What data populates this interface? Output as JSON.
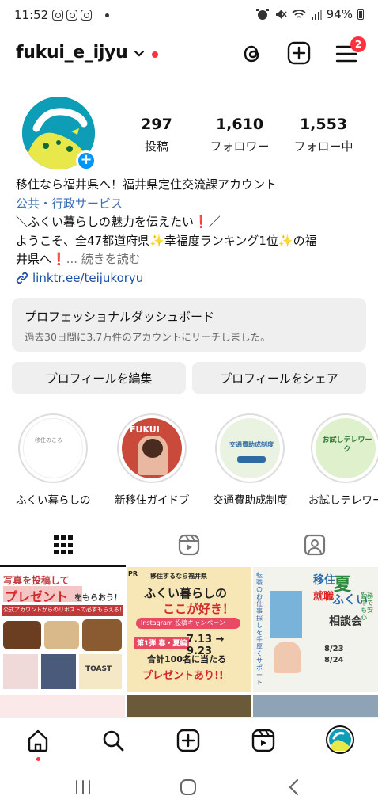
{
  "status_bar": {
    "time": "11:52",
    "battery": "94%"
  },
  "header": {
    "username": "fukui_e_ijyu",
    "menu_badge": "2"
  },
  "stats": [
    {
      "value": "297",
      "label": "投稿"
    },
    {
      "value": "1,610",
      "label": "フォロワー"
    },
    {
      "value": "1,553",
      "label": "フォロー中"
    }
  ],
  "bio": {
    "line1": "移住なら福井県へ！福井県定住交流課アカウント",
    "category": "公共・行政サービス",
    "line3": "＼ふくい暮らしの魅力を伝えたい",
    "line3_end": "／",
    "line4a": "ようこそ、全47都道府県",
    "line4b": "幸福度ランキング1位",
    "line4c": "の福",
    "line5": "井県へ",
    "more": "... 続きを読む",
    "link": "linktr.ee/teijukoryu"
  },
  "dashboard": {
    "title": "プロフェッショナルダッシュボード",
    "subtitle": "過去30日間に3.7万件のアカウントにリーチしました。"
  },
  "buttons": {
    "edit": "プロフィールを編集",
    "share": "プロフィールをシェア"
  },
  "highlights": [
    {
      "label": "ふくい暮らしの…",
      "thumb_text": "移住のころ"
    },
    {
      "label": "新移住ガイドブ…",
      "thumb_text": "FUKUI"
    },
    {
      "label": "交通費助成制度",
      "thumb_text": "交通費助成制度"
    },
    {
      "label": "お試しテレワー…",
      "thumb_text": "お試しテレワーク"
    }
  ],
  "posts": [
    {
      "line1": "写真を投稿して",
      "line2": "プレゼント",
      "line3": "をもらおう！",
      "line4": "公式アカウントからのリポストで必ずもらえる！",
      "toast": "TOAST"
    },
    {
      "pr": "PR",
      "top": "移住するなら福井県",
      "title1": "ふくい暮らしの",
      "title2": "ここが好き！",
      "insta": "Instagram 投稿キャンペーン",
      "period": "第1弾 春・夏編",
      "dates": "7.13 → 9.23",
      "winners": "合計100名に当たる",
      "present": "プレゼントあり!!"
    },
    {
      "side": "転職のお仕事探しを手厚くサポート",
      "big1": "夏",
      "big2": "ふくい",
      "mid": "移住",
      "job": "就職",
      "sodan": "相談会",
      "date1": "8/23",
      "date2": "8/24",
      "note": "勤務中でも安心"
    }
  ],
  "colors": {
    "accent_red": "#ff3040",
    "link_blue": "#1b4fa8",
    "category_blue": "#3b6fb6",
    "button_bg": "#efefef",
    "avatar_teal": "#0e9db6",
    "avatar_yellow": "#e8e84a"
  },
  "icons": [
    "threads-icon",
    "plus-square-icon",
    "menu-icon",
    "grid-icon",
    "reels-icon",
    "tagged-icon",
    "home-icon",
    "search-icon",
    "create-icon",
    "reels-nav-icon",
    "profile-avatar-icon"
  ]
}
